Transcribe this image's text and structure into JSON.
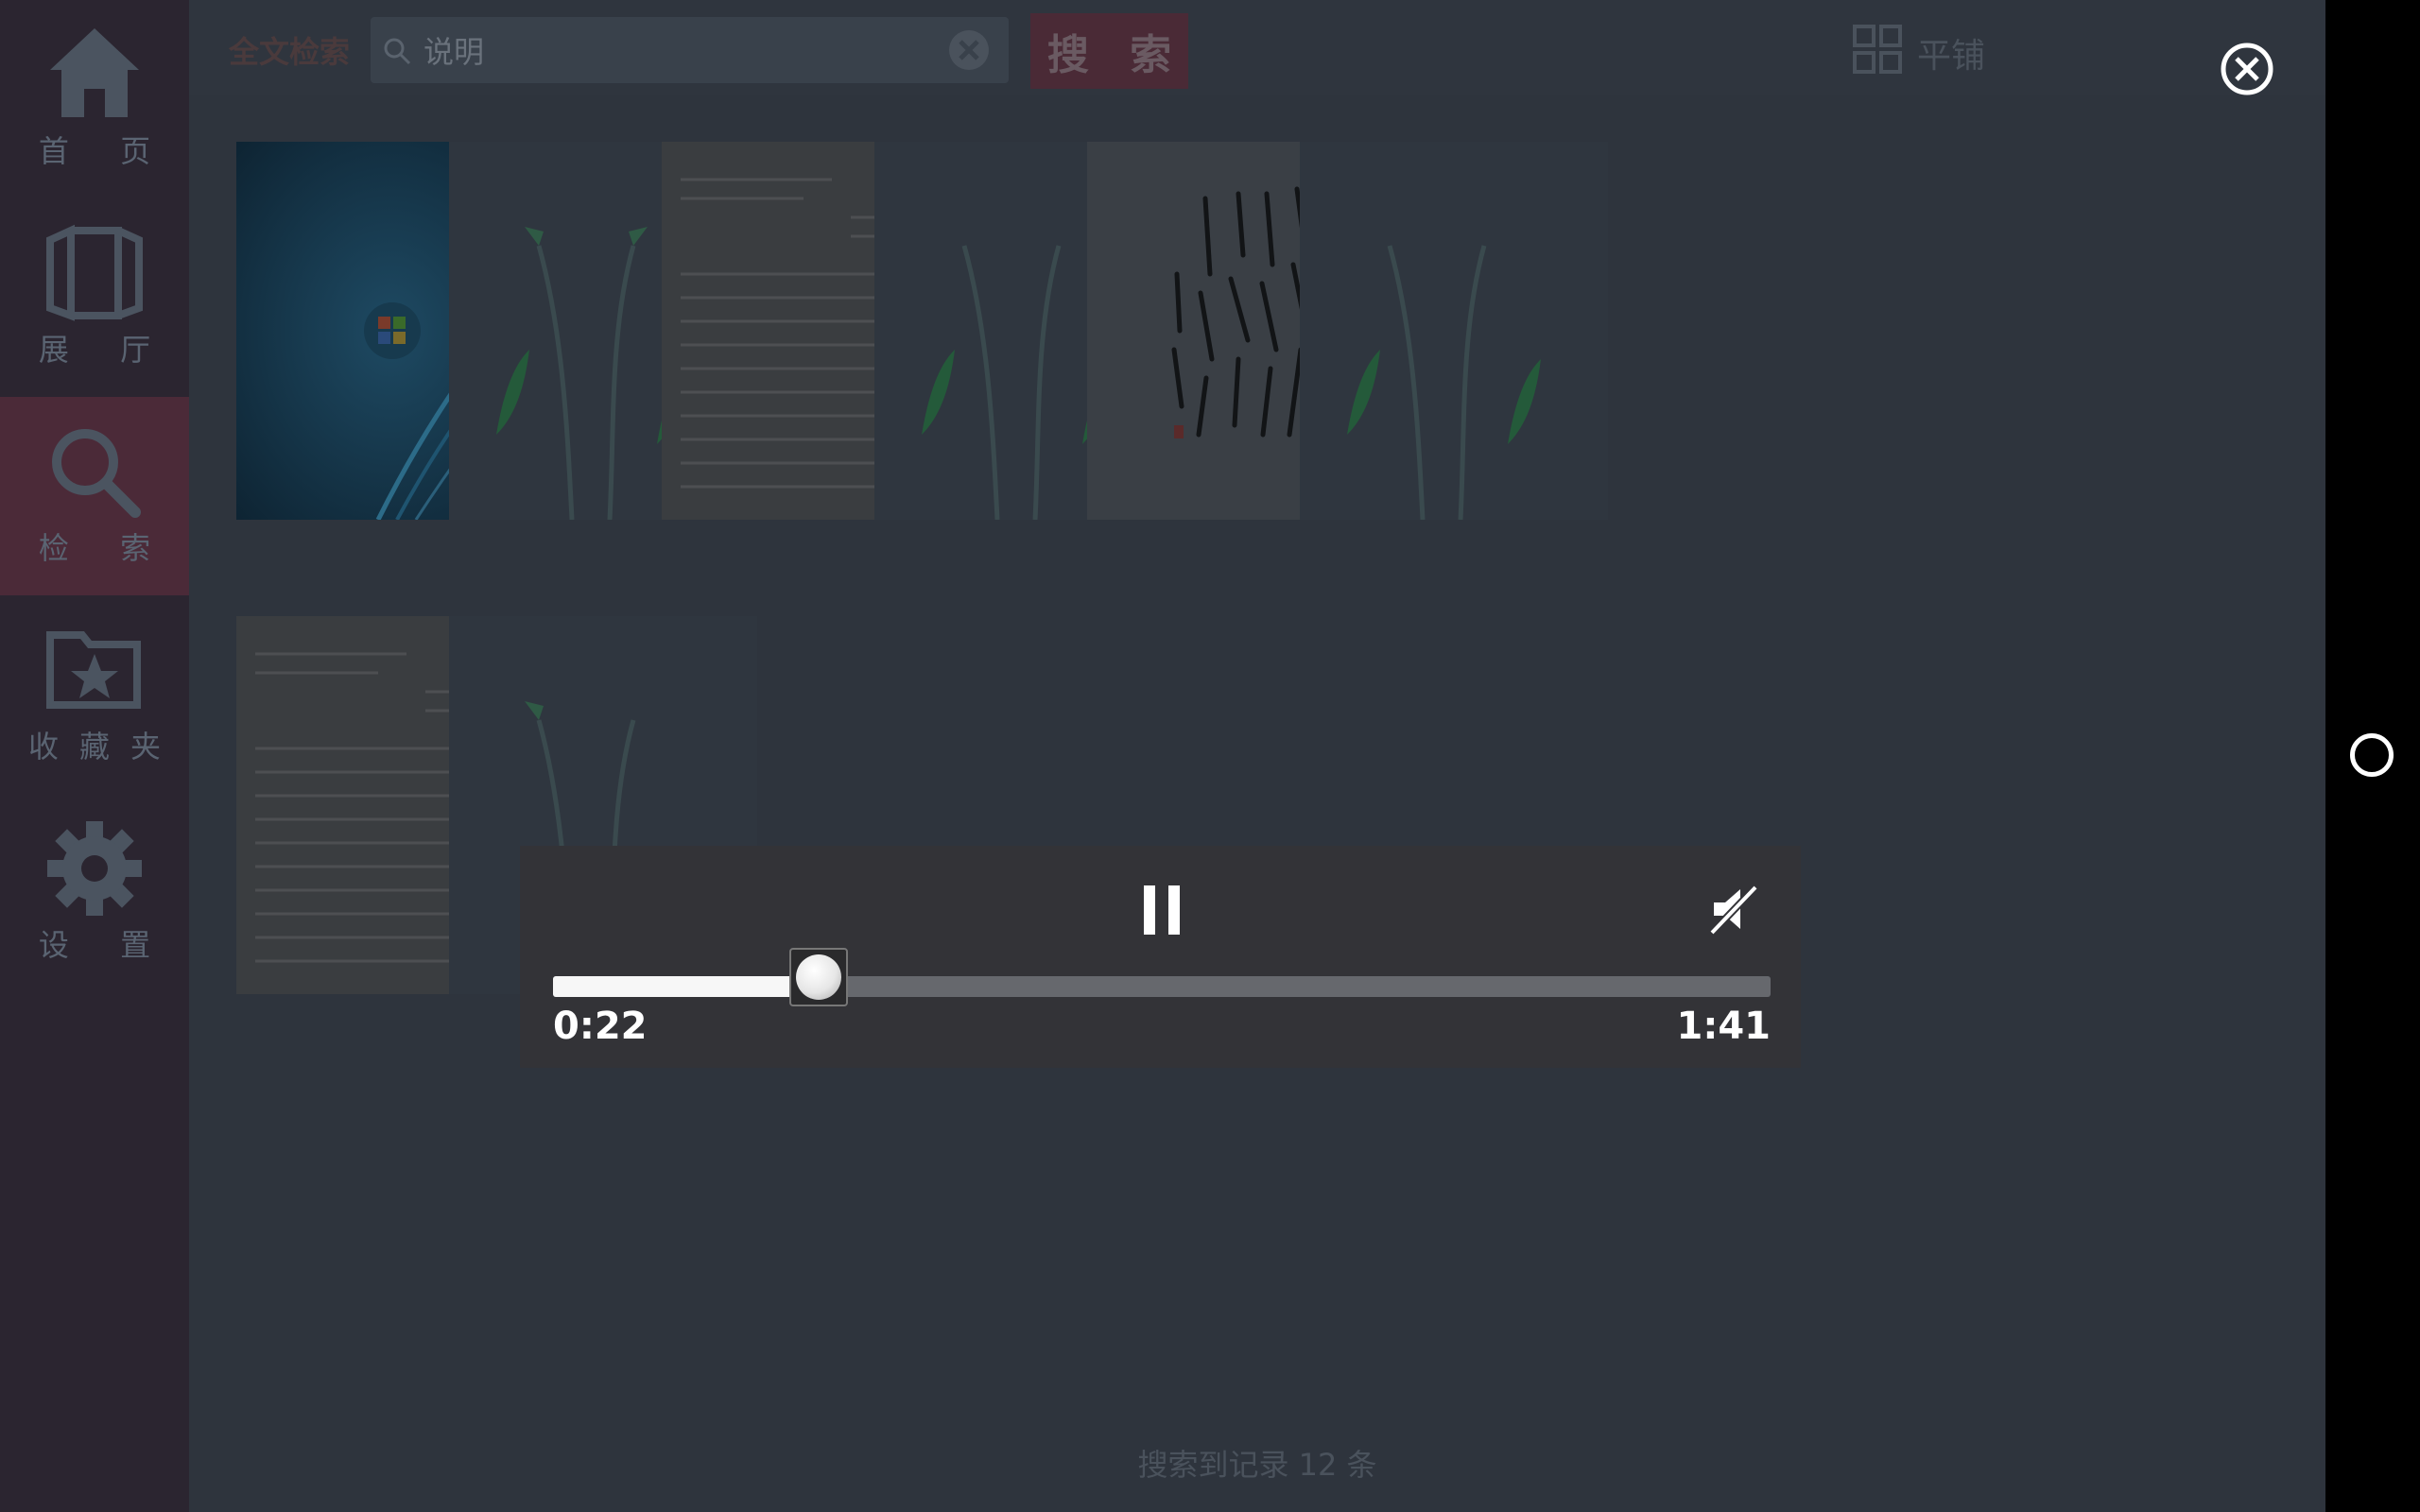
{
  "sidebar": {
    "items": [
      {
        "label": "首 页",
        "icon": "home-icon"
      },
      {
        "label": "展 厅",
        "icon": "gallery-icon"
      },
      {
        "label": "检 索",
        "icon": "search-icon",
        "active": true
      },
      {
        "label": "收藏夹",
        "icon": "favorites-folder-icon"
      },
      {
        "label": "设 置",
        "icon": "gear-icon"
      }
    ]
  },
  "topbar": {
    "search_mode_label": "全文检索",
    "search_value": "说明",
    "search_button_label": "搜 索",
    "view_toggle_label": "平铺"
  },
  "results": {
    "items": [
      {
        "type": "windows-wallpaper"
      },
      {
        "type": "plant-placeholder"
      },
      {
        "type": "handwritten-document"
      },
      {
        "type": "plant-placeholder"
      },
      {
        "type": "calligraphy"
      },
      {
        "type": "plant-placeholder"
      },
      {
        "type": "handwritten-document"
      },
      {
        "type": "plant-placeholder"
      }
    ],
    "count_text": "搜索到记录 12 条"
  },
  "media": {
    "state": "playing",
    "current_time": "0:22",
    "total_time": "1:41",
    "progress_fraction": 0.218,
    "muted": true
  },
  "colors": {
    "sidebar_bg": "#2b2530",
    "sidebar_active_bg": "#4b2a38",
    "main_bg": "#2e343d",
    "panel_bg": "#333337",
    "accent_button": "#4a2a36"
  }
}
